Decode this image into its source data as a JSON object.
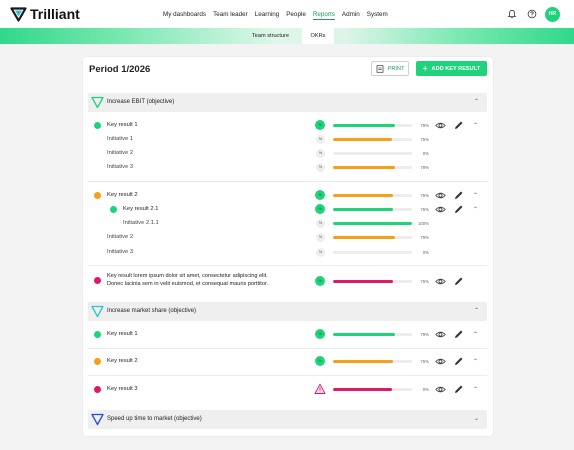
{
  "app": {
    "name": "Trilliant",
    "avatar_initials": "HR"
  },
  "nav": [
    "My dashboards",
    "Team leader",
    "Learning",
    "People",
    "Reports",
    "Admin",
    "System"
  ],
  "nav_active": "Reports",
  "top_icons": [
    "bell-icon",
    "help-icon"
  ],
  "subnav": {
    "tabs": [
      "Team structure",
      "OKRs"
    ],
    "active": "OKRs"
  },
  "page": {
    "period": "Period 1/2026",
    "print_label": "PRINT",
    "add_label": "ADD KEY RESULT"
  },
  "colors": {
    "green": "#1ed37a",
    "orange": "#f5a017",
    "pink": "#e0176a",
    "blue": "#2a4bd7",
    "teal": "#2fc3c9"
  },
  "objectives": [
    {
      "title": "Increase EBIT (objective)"
    },
    {
      "title": "Increase market share (objective)"
    },
    {
      "title": "Speed up time to market (objective)"
    }
  ],
  "rows": {
    "kr1": {
      "label": "Key result 1",
      "pct": "78%",
      "fill": 0.78
    },
    "i1": {
      "label": "Initiative 1",
      "pct": "75%",
      "fill": 0.75
    },
    "i2": {
      "label": "Initiative 2",
      "pct": "0%",
      "fill": 0
    },
    "i3": {
      "label": "Initiative 3",
      "pct": "78%",
      "fill": 0.78
    },
    "kr2": {
      "label": "Key result 2",
      "pct": "76%",
      "fill": 0.76
    },
    "kr21": {
      "label": "Key result 2.1",
      "pct": "76%",
      "fill": 0.76
    },
    "i211": {
      "label": "Initiative 2.1.1",
      "pct": "100%",
      "fill": 1.0
    },
    "i2b": {
      "label": "Initiative 2",
      "pct": "79%",
      "fill": 0.79
    },
    "i3b": {
      "label": "Initiative 3",
      "pct": "0%",
      "fill": 0
    },
    "krlong": {
      "line1": "Key result lorem ipsum dolor sit amet, consectetur adipiscing elit.",
      "line2": "Donec lacinia sem in velit euismod, et consequat mauris porttitor.",
      "pct": "76%",
      "fill": 0.76
    },
    "m_kr1": {
      "label": "Key result 1",
      "pct": "79%",
      "fill": 0.79
    },
    "m_kr2": {
      "label": "Key result 2",
      "pct": "76%",
      "fill": 0.76
    },
    "m_kr3": {
      "label": "Key result 3",
      "pct": "0%",
      "fill": 0.75
    }
  }
}
